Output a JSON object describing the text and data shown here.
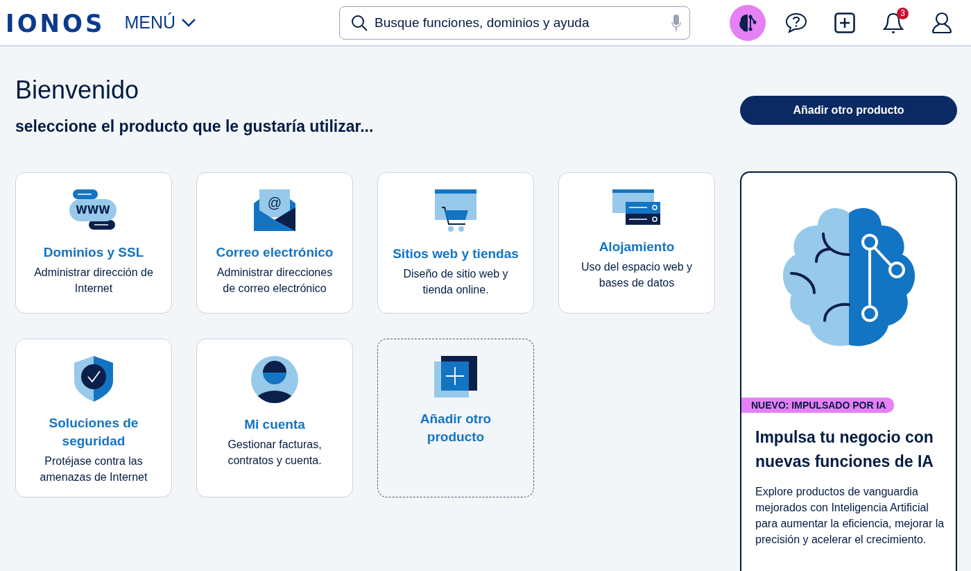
{
  "header": {
    "logo": "IONOS",
    "menu_label": "MENÚ",
    "search": {
      "placeholder": "Busque funciones, dominios y ayuda"
    },
    "notifications_count": "3"
  },
  "welcome": {
    "title": "Bienvenido",
    "subtitle": "seleccione el producto que le gustaría utilizar..."
  },
  "add_button": "Añadir otro producto",
  "products": [
    {
      "kind": "domain",
      "icon_text": "WWW",
      "title": "Dominios y SSL",
      "description": "Administrar dirección de Internet"
    },
    {
      "kind": "mail",
      "icon_text": "@",
      "title": "Correo electrónico",
      "description": "Administrar direcciones de correo electrónico"
    },
    {
      "kind": "webshop",
      "title": "Sitios web y tiendas",
      "description": "Diseño de sitio web y tienda online."
    },
    {
      "kind": "hosting",
      "title": "Alojamiento",
      "description": "Uso del espacio web y bases de datos"
    },
    {
      "kind": "security",
      "title": "Soluciones de seguridad",
      "description": "Protéjase contra las amenazas de Internet"
    },
    {
      "kind": "account",
      "title": "Mi cuenta",
      "description": "Gestionar facturas, contratos y cuenta."
    },
    {
      "kind": "add",
      "title": "Añadir otro producto"
    }
  ],
  "promo": {
    "tag": "NUEVO: IMPULSADO POR IA",
    "title": "Impulsa tu negocio con nuevas funciones de IA",
    "text": "Explore productos de vanguardia mejorados con Inteligencia Artificial para aumentar la eficiencia, mejorar la precisión y acelerar el crecimiento."
  }
}
